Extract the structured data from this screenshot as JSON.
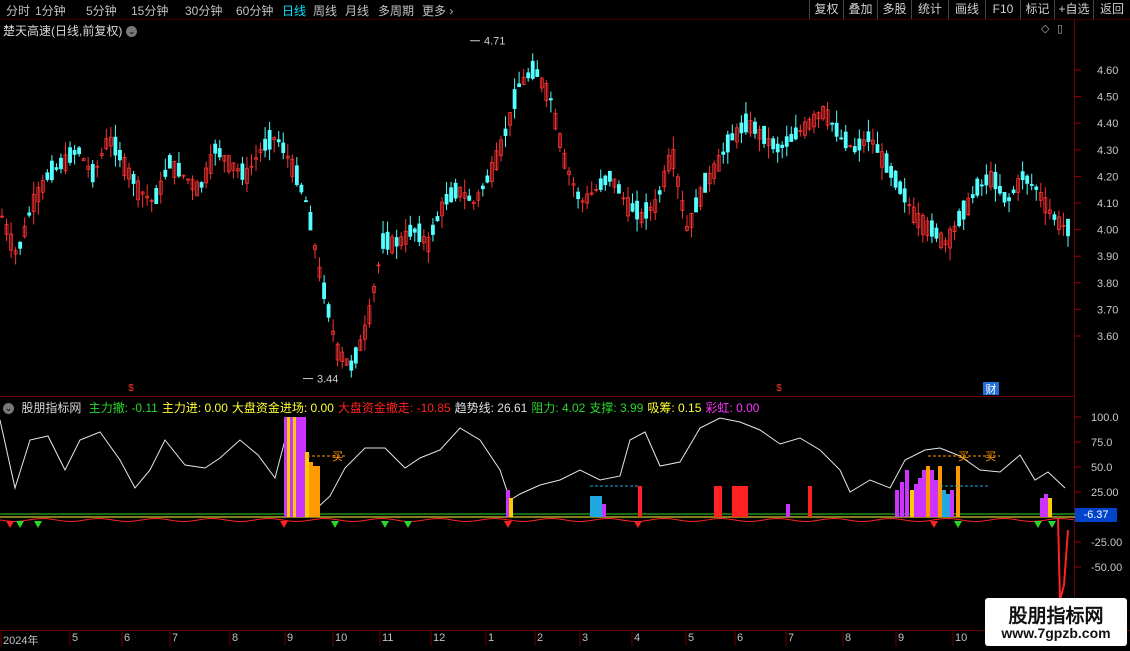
{
  "toolbar": {
    "periods": [
      "分时",
      "1分钟",
      "5分钟",
      "15分钟",
      "30分钟",
      "60分钟",
      "日线",
      "周线",
      "月线",
      "多周期",
      "更多"
    ],
    "active_period": "日线",
    "buttons": [
      "复权",
      "叠加",
      "多股",
      "统计",
      "画线",
      "F10",
      "标记",
      "+自选",
      "返回"
    ]
  },
  "stock": {
    "title": "楚天高速(日线,前复权)"
  },
  "price_axis": {
    "ticks": [
      "4.60",
      "4.50",
      "4.40",
      "4.30",
      "4.20",
      "4.10",
      "4.00",
      "3.90",
      "3.80",
      "3.70",
      "3.60"
    ]
  },
  "price_marks": {
    "high": "4.71",
    "low": "3.44"
  },
  "event_marks": {
    "dividend1": "$",
    "dividend2": "$",
    "finance": "财"
  },
  "indicator": {
    "name": "股朋指标网",
    "items": [
      {
        "label": "主力撤: ",
        "value": "-0.11",
        "color": "#2bd62b"
      },
      {
        "label": "主力进: ",
        "value": "0.00",
        "color": "#ffff33"
      },
      {
        "label": "大盘资金进场: ",
        "value": "0.00",
        "color": "#ffff33"
      },
      {
        "label": "大盘资金撤走: ",
        "value": "-10.85",
        "color": "#ff2222"
      },
      {
        "label": "趋势线: ",
        "value": "26.61",
        "color": "#e0e0e0"
      },
      {
        "label": "阻力: ",
        "value": "4.02",
        "color": "#2bd62b"
      },
      {
        "label": "支撑: ",
        "value": "3.99",
        "color": "#2bd62b"
      },
      {
        "label": "吸筹: ",
        "value": "0.15",
        "color": "#ffff33"
      },
      {
        "label": "彩虹: ",
        "value": "0.00",
        "color": "#ff33ff"
      }
    ],
    "axis_ticks": [
      "100.0",
      "75.0",
      "50.0",
      "25.00",
      "-25.00",
      "-50.00"
    ],
    "current_value": "-6.37",
    "buy_labels": [
      "买",
      "买",
      "买"
    ]
  },
  "time_axis": {
    "labels": [
      "2024年",
      "5",
      "6",
      "7",
      "8",
      "9",
      "10",
      "11",
      "12",
      "1",
      "2",
      "3",
      "4",
      "5",
      "6",
      "7",
      "8",
      "9",
      "10"
    ]
  },
  "watermark": {
    "name": "股朋指标网",
    "url": "www.7gpzb.com"
  },
  "chart_data": {
    "type": "candlestick",
    "title": "楚天高速(日线,前复权)",
    "ylim": [
      3.44,
      4.71
    ],
    "close_approx": [
      4.05,
      3.9,
      4.1,
      4.2,
      4.25,
      4.3,
      4.2,
      4.35,
      4.25,
      4.15,
      4.1,
      4.25,
      4.2,
      4.15,
      4.3,
      4.25,
      4.2,
      4.3,
      4.35,
      4.25,
      4.1,
      3.8,
      3.55,
      3.48,
      3.65,
      3.95,
      3.95,
      4.0,
      3.95,
      4.1,
      4.15,
      4.1,
      4.2,
      4.35,
      4.55,
      4.6,
      4.5,
      4.25,
      4.1,
      4.15,
      4.2,
      4.1,
      4.05,
      4.1,
      4.3,
      4.0,
      4.15,
      4.25,
      4.35,
      4.4,
      4.35,
      4.3,
      4.35,
      4.4,
      4.45,
      4.35,
      4.3,
      4.35,
      4.25,
      4.15,
      4.05,
      4.0,
      3.95,
      4.05,
      4.15,
      4.2,
      4.1,
      4.2,
      4.15,
      4.05,
      4.0
    ]
  }
}
